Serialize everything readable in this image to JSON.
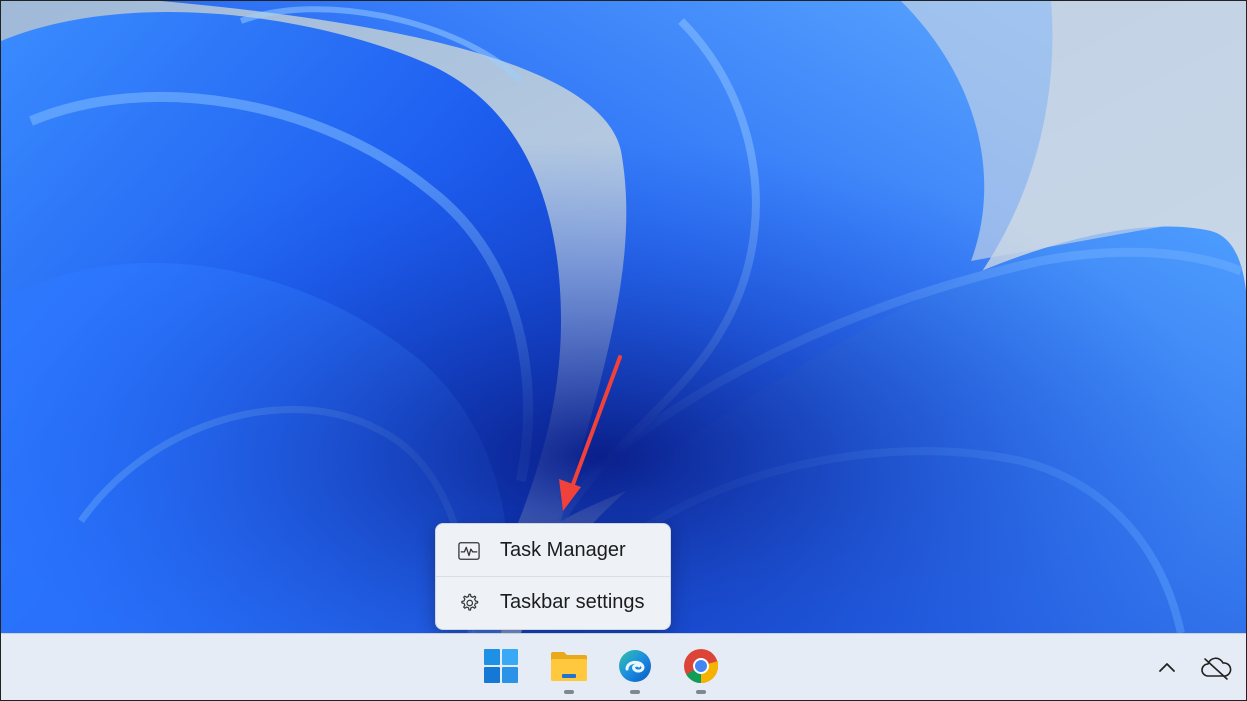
{
  "context_menu": {
    "items": [
      {
        "label": "Task Manager",
        "icon": "task-manager-icon"
      },
      {
        "label": "Taskbar settings",
        "icon": "gear-icon"
      }
    ]
  },
  "taskbar": {
    "apps": [
      {
        "name": "start",
        "icon": "windows-start-icon"
      },
      {
        "name": "file-explorer",
        "icon": "folder-icon"
      },
      {
        "name": "edge",
        "icon": "edge-icon"
      },
      {
        "name": "chrome",
        "icon": "chrome-icon"
      }
    ],
    "tray": {
      "overflow_icon": "chevron-up-icon",
      "onedrive_icon": "onedrive-cloud-icon"
    }
  },
  "colors": {
    "annotation_arrow": "#f0413a",
    "wallpaper_blue": "#1f5fe8",
    "taskbar_bg": "#e6ecf5"
  }
}
